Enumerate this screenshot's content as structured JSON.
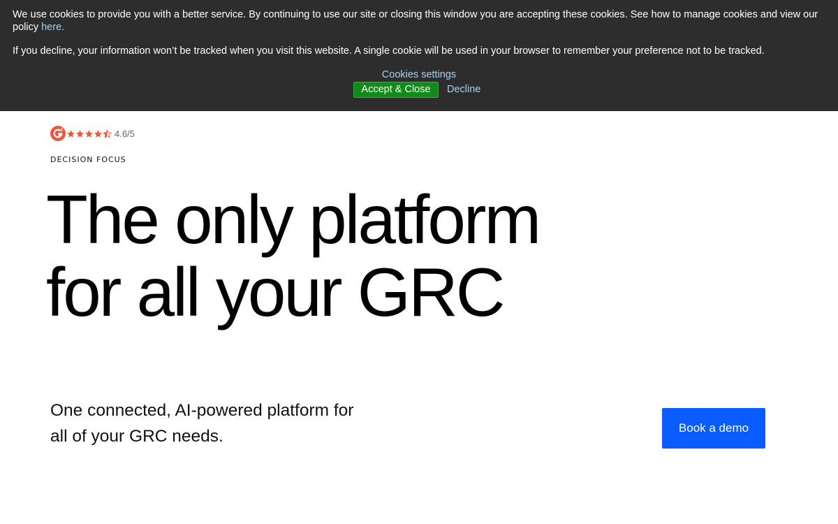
{
  "cookie_banner": {
    "message": "We use cookies to provide you with a better service. By continuing to use our site or closing this window you are accepting these cookies. See how to manage cookies and view our policy",
    "link_text": "here.",
    "decline_info": "If you decline, your information won’t be tracked when you visit this website. A single cookie will be used in your browser to remember your preference not to be tracked.",
    "settings_label": "Cookies settings",
    "accept_label": "Accept & Close",
    "decline_label": "Decline"
  },
  "rating": {
    "logo": "g2-logo-icon",
    "stars": 4.5,
    "max_stars": 5,
    "text": "4.6/5",
    "color": "#f2543b"
  },
  "hero": {
    "eyebrow": "DECISION FOCUS",
    "headline_line1": "The only platform",
    "headline_line2": "for all your GRC",
    "subhead_line1": "One connected, AI-powered platform for",
    "subhead_line2": "all of your GRC needs.",
    "cta_label": "Book a demo",
    "cta_color": "#0a5cff"
  }
}
